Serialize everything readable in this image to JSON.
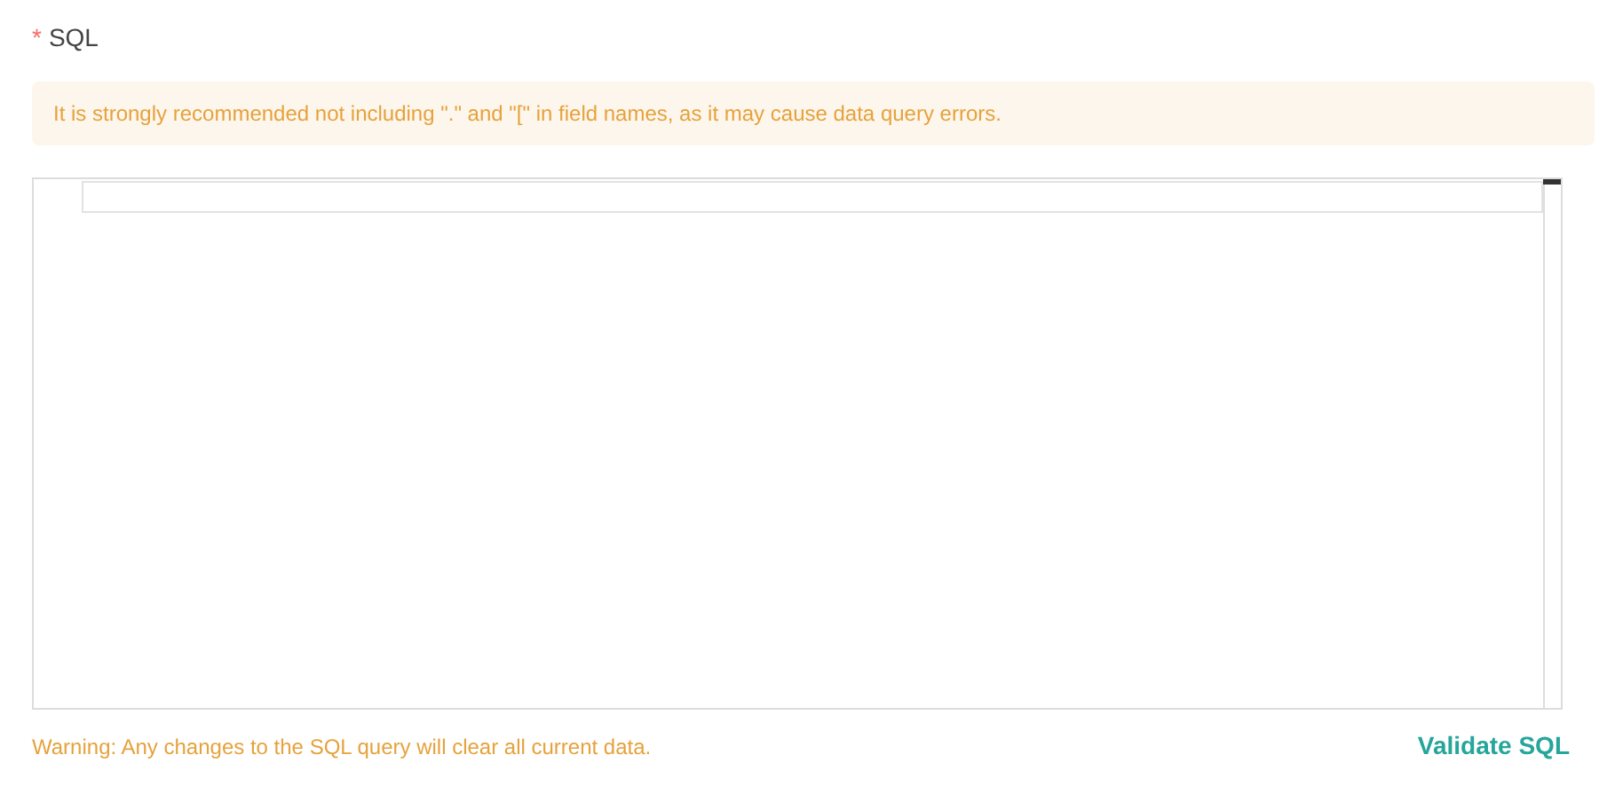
{
  "field": {
    "label": "SQL",
    "required_mark": "*"
  },
  "alert": {
    "text": "It is strongly recommended not including \".\" and \"[\" in field names, as it may cause data query errors."
  },
  "footer": {
    "warning": "Warning: Any changes to the SQL query will clear all current data.",
    "button": "Validate SQL"
  }
}
